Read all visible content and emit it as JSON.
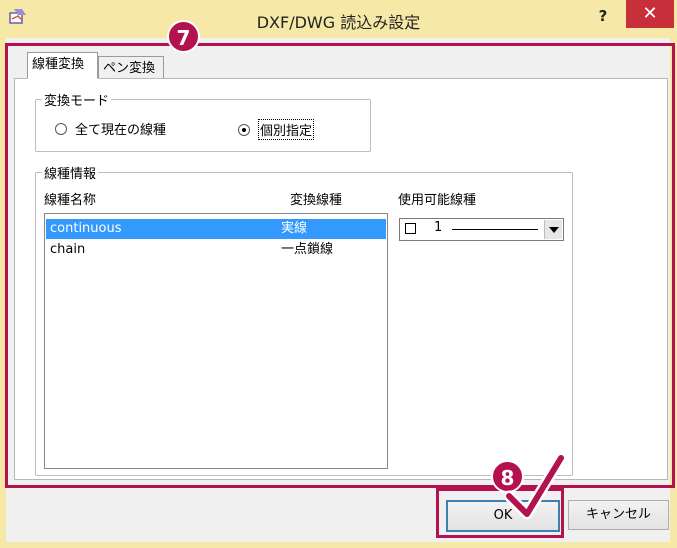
{
  "window": {
    "title": "DXF/DWG 読込み設定",
    "help_label": "?",
    "close_label": "✕"
  },
  "tabs": [
    {
      "label": "線種変換",
      "active": true
    },
    {
      "label": "ペン変換",
      "active": false
    }
  ],
  "mode_group": {
    "title": "変換モード",
    "options": [
      {
        "label": "全て現在の線種",
        "selected": false
      },
      {
        "label": "個別指定",
        "selected": true
      }
    ]
  },
  "linetype_group": {
    "title": "線種情報",
    "columns": [
      "線種名称",
      "変換線種",
      "使用可能線種"
    ],
    "rows": [
      {
        "name": "continuous",
        "convert": "実線",
        "selected": true
      },
      {
        "name": "chain",
        "convert": "一点鎖線",
        "selected": false
      }
    ],
    "available_select": {
      "value": "1"
    }
  },
  "buttons": {
    "ok": "OK",
    "cancel": "キャンセル"
  },
  "annotations": {
    "step7": "7",
    "step8": "8",
    "color": "#b4124f"
  },
  "colors": {
    "title_bar": "#f6e9a8",
    "close_button": "#c7303b",
    "selection": "#3399ff"
  }
}
